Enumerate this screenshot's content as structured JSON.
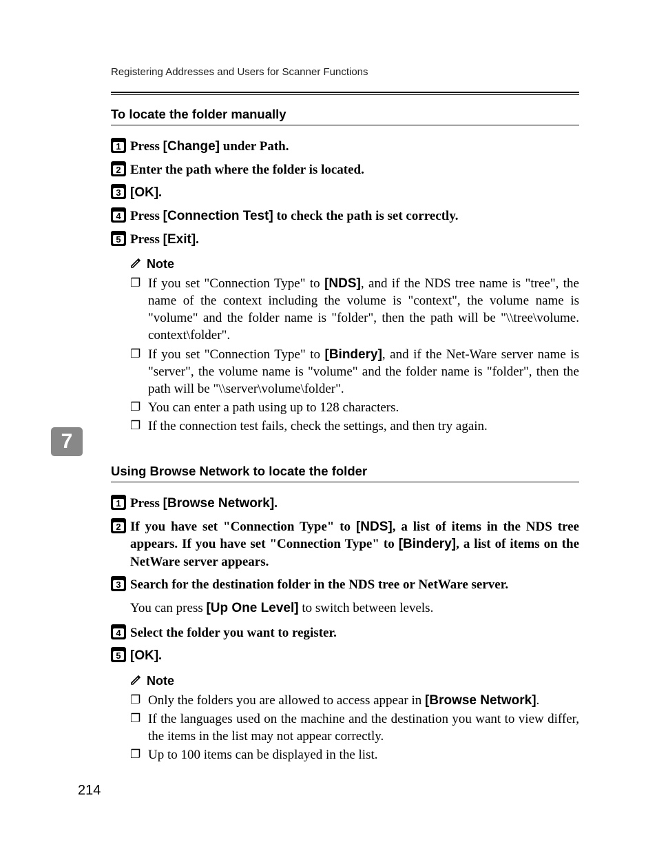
{
  "running_head": "Registering Addresses and Users for Scanner Functions",
  "chapter_tab": "7",
  "page_number": "214",
  "section1": {
    "title": "To locate the folder manually",
    "steps": {
      "s1_a": "Press ",
      "s1_ui": "[Change]",
      "s1_b": " under Path.",
      "s2": "Enter the path where the folder is located.",
      "s3_ui": "[OK]",
      "s3_b": ".",
      "s4_a": "Press ",
      "s4_ui": "[Connection Test]",
      "s4_b": " to check the path is set correctly.",
      "s5_a": "Press ",
      "s5_ui": "[Exit]",
      "s5_b": "."
    },
    "note_label": "Note",
    "notes": {
      "n1_a": "If you set \"Connection Type\" to ",
      "n1_ui": "[NDS]",
      "n1_b": ", and if the NDS tree name is \"tree\", the name of the context including the volume is \"context\", the volume name is \"volume\" and the folder name is \"folder\", then the path will be \"\\\\tree\\volume. context\\folder\".",
      "n2_a": "If you set \"Connection Type\" to ",
      "n2_ui": "[Bindery]",
      "n2_b": ", and if the Net-Ware server name is \"server\", the volume name is \"volume\" and the folder name is \"folder\", then the path will be \"\\\\server\\volume\\folder\".",
      "n3": "You can enter a path using up to 128 characters.",
      "n4": "If the connection test fails, check the settings, and then try again."
    }
  },
  "section2": {
    "title": "Using Browse Network to locate the folder",
    "steps": {
      "s1_a": "Press ",
      "s1_ui": "[Browse Network]",
      "s1_b": ".",
      "s2_a": "If you have set \"Connection Type\" to ",
      "s2_ui1": "[NDS]",
      "s2_b": ", a list of items in the NDS tree appears. If you have set \"Connection Type\" to ",
      "s2_ui2": "[Bindery]",
      "s2_c": ", a list of items on the NetWare server appears.",
      "s3": "Search for the destination folder in the NDS tree or NetWare server.",
      "s3_follow_a": "You can press ",
      "s3_follow_ui": "[Up One Level]",
      "s3_follow_b": " to switch between levels.",
      "s4": "Select the folder you want to register.",
      "s5_ui": "[OK]",
      "s5_b": "."
    },
    "note_label": "Note",
    "notes": {
      "n1_a": "Only the folders you are allowed to access appear in ",
      "n1_ui": "[Browse Network]",
      "n1_b": ".",
      "n2": "If the languages used on the machine and the destination you want to view differ, the items in the list may not appear correctly.",
      "n3": "Up to 100 items can be displayed in the list."
    }
  }
}
